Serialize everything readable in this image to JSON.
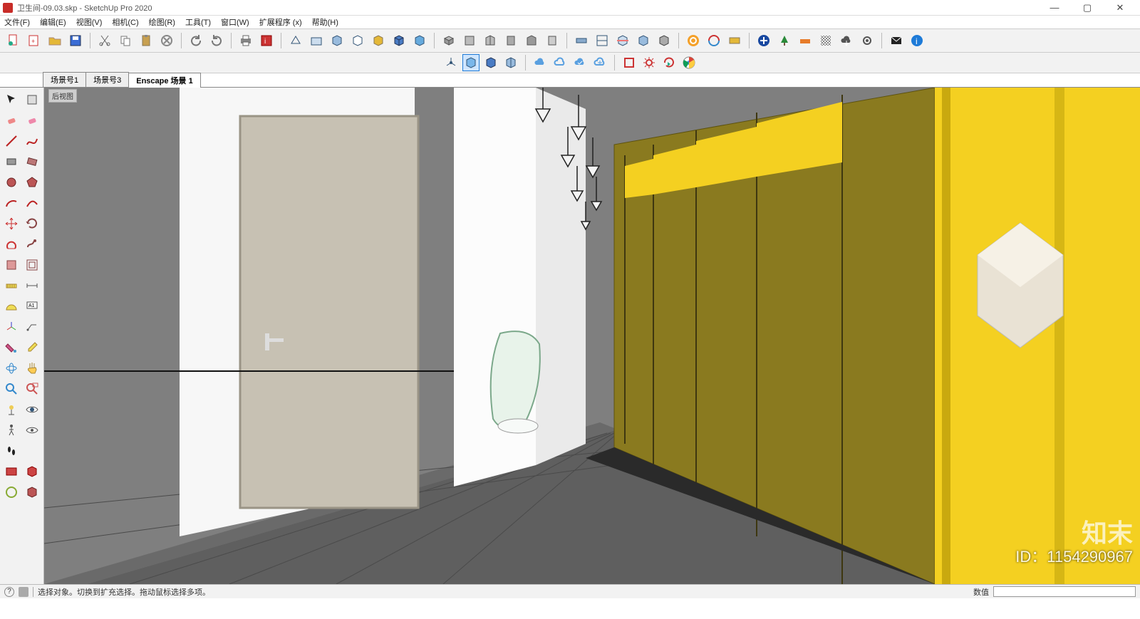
{
  "title_bar": {
    "app_icon": "sketchup-icon",
    "title": "卫生间-09.03.skp - SketchUp Pro 2020",
    "win_min": "—",
    "win_max": "▢",
    "win_close": "✕"
  },
  "menu": {
    "items": [
      "文件(F)",
      "编辑(E)",
      "视图(V)",
      "相机(C)",
      "绘图(R)",
      "工具(T)",
      "窗口(W)",
      "扩展程序 (x)",
      "帮助(H)"
    ]
  },
  "main_toolbar": {
    "groups": [
      [
        "new-file-icon",
        "new-template-icon",
        "open-file-icon",
        "save-file-icon"
      ],
      [
        "cut-icon",
        "copy-icon",
        "paste-icon",
        "delete-icon"
      ],
      [
        "undo-icon",
        "redo-icon"
      ],
      [
        "print-icon",
        "model-info-icon"
      ]
    ],
    "styles": [
      "style-wire-icon",
      "style-hidden-icon",
      "style-shaded-icon",
      "style-shaded-tex-icon",
      "style-mono-icon",
      "style-xray-icon",
      "style-back-icon"
    ],
    "views": [
      "iso-icon",
      "top-icon",
      "front-icon",
      "right-icon",
      "back-icon",
      "left-icon"
    ],
    "section": [
      "section-plane-icon",
      "section-display-icon",
      "section-cut-icon",
      "section-fill-icon",
      "section-profile-icon"
    ],
    "enscape": [
      "enscape-sync-icon",
      "enscape-start-icon",
      "enscape-live-icon"
    ],
    "vray": [
      "vray-add-icon",
      "vray-tree-icon",
      "vray-light-icon",
      "vray-mat-icon",
      "vray-cloud-icon",
      "vray-settings-icon"
    ],
    "misc": [
      "mail-icon",
      "info-icon"
    ]
  },
  "sec_toolbar": {
    "group1": [
      "axis-style-icon",
      "face-front-icon",
      "face-back-icon",
      "face-both-icon"
    ],
    "group2": [
      "cloud-a-icon",
      "cloud-b-icon",
      "cloud-c-icon",
      "cloud-d-icon"
    ],
    "group3": [
      "bbox-icon",
      "gear-icon",
      "refresh-play-icon",
      "chrome-icon"
    ]
  },
  "scene_tabs": {
    "tabs": [
      {
        "label": "场景号1",
        "active": false
      },
      {
        "label": "场景号3",
        "active": false
      },
      {
        "label": "Enscape 场景 1",
        "active": true
      }
    ]
  },
  "viewport": {
    "label": "后视图"
  },
  "left_toolbar": {
    "tools": [
      "select-icon",
      "component-icon",
      "eraser-1-icon",
      "eraser-2-icon",
      "line-icon",
      "freehand-icon",
      "rect-icon",
      "rot-rect-icon",
      "circle-icon",
      "polygon-icon",
      "arc-icon",
      "arc2-icon",
      "move-icon",
      "rotate-icon",
      "pushpull-icon",
      "followme-icon",
      "scale-icon",
      "offset-icon",
      "tape-icon",
      "dimension-icon",
      "protractor-icon",
      "text-icon",
      "axes-icon",
      "label-icon",
      "paint-icon",
      "sample-icon",
      "orbit-icon",
      "pan-icon",
      "zoom-icon",
      "zoom-window-icon",
      "position-camera-icon",
      "look-icon",
      "walk-icon",
      "eye-icon",
      "footprints-icon",
      "blank-icon",
      "ext-a-icon",
      "ext-b-icon",
      "ext-c-icon",
      "ext-d-icon"
    ]
  },
  "status_bar": {
    "hint": "选择对象。切换到扩充选择。拖动鼠标选择多项。",
    "value_label": "数值",
    "value": ""
  },
  "watermark": {
    "logo": "知末",
    "id": "ID：1154290967"
  },
  "colors": {
    "accent": "#1e7bd8",
    "wall_gray": "#7f7f7f",
    "floor_gray": "#5e5e5e",
    "door_beige": "#c7c1b3",
    "partition_olive": "#8a7a1f",
    "yellow": "#f4d021"
  }
}
